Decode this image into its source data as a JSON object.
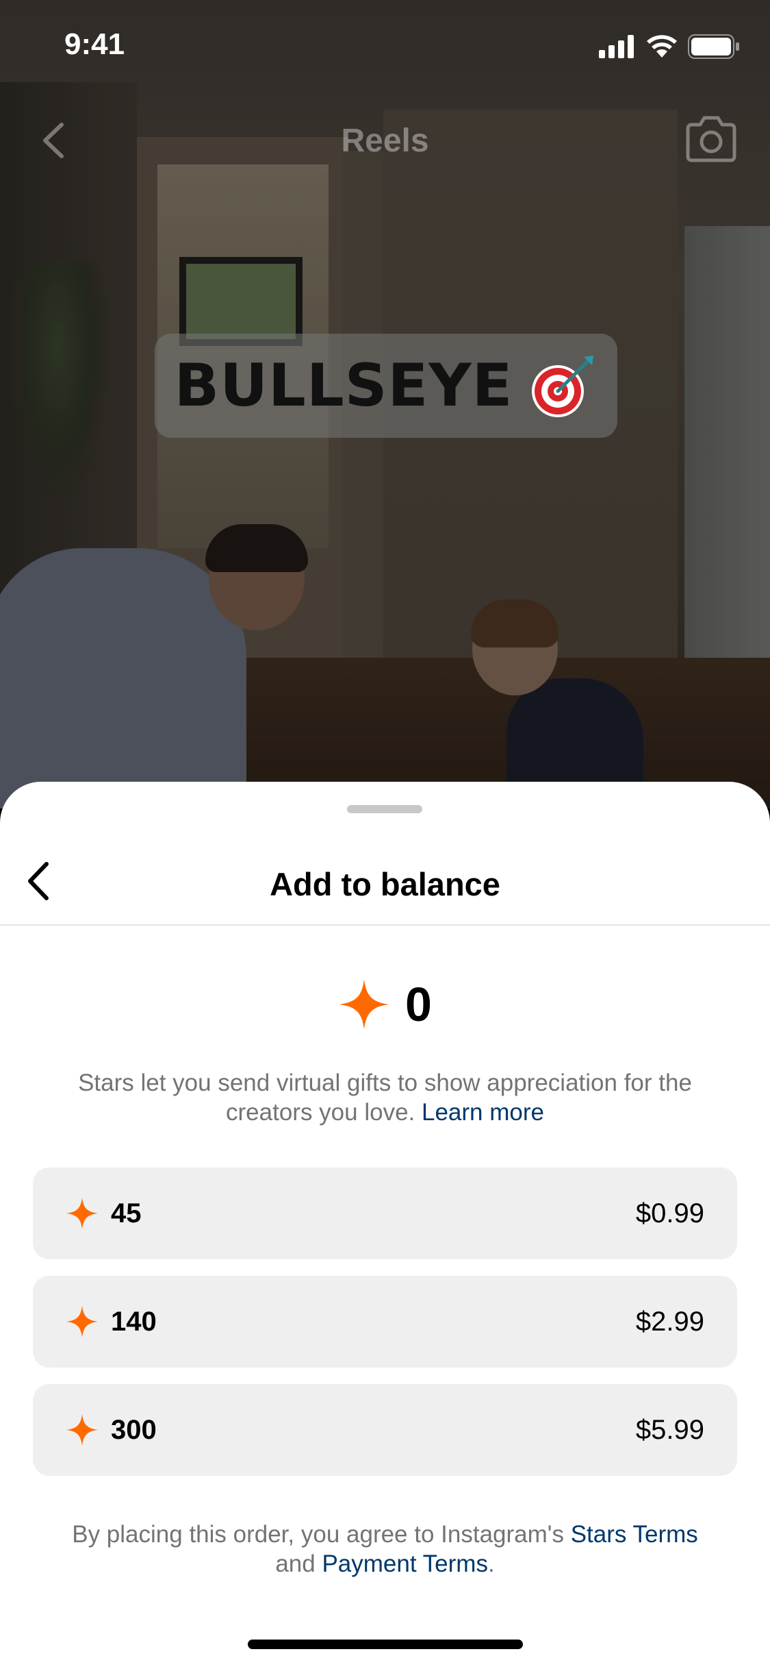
{
  "status_bar": {
    "time": "9:41"
  },
  "top_nav": {
    "title": "Reels"
  },
  "video": {
    "sticker_text": "BULLSEYE"
  },
  "sheet": {
    "title": "Add to balance",
    "balance": "0",
    "description": "Stars let you send virtual gifts to show appreciation for the creators you love.",
    "learn_more": "Learn more",
    "options": [
      {
        "amount": "45",
        "price": "$0.99"
      },
      {
        "amount": "140",
        "price": "$2.99"
      },
      {
        "amount": "300",
        "price": "$5.99"
      }
    ],
    "terms_prefix": "By placing this order, you agree to Instagram's",
    "stars_terms": "Stars Terms",
    "terms_and": "and",
    "payment_terms": "Payment Terms",
    "terms_suffix": "."
  },
  "colors": {
    "star": "#ff6a00",
    "link": "#00376b",
    "option_bg": "#efefef"
  },
  "icons": [
    "back-icon",
    "camera-icon",
    "target-icon",
    "star-icon",
    "signal-icon",
    "wifi-icon",
    "battery-icon"
  ]
}
